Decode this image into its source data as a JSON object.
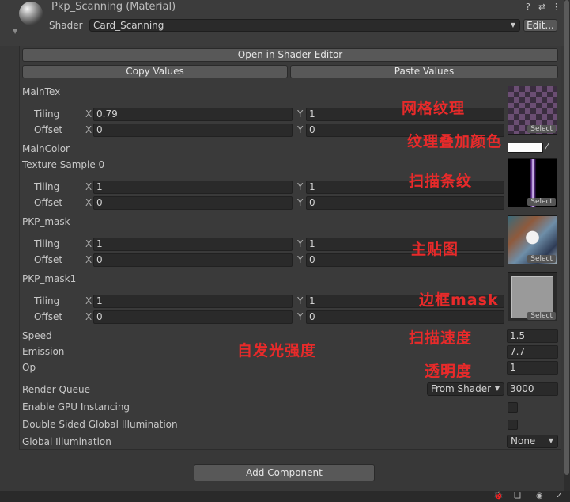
{
  "header": {
    "title": "Pkp_Scanning (Material)",
    "shader_label": "Shader",
    "shader_value": "Card_Scanning",
    "edit_button": "Edit...",
    "help_icon": "?",
    "settings_icon": "⇄",
    "menu_icon": "⋮",
    "fold_icon": "▼"
  },
  "buttons": {
    "open_shader_editor": "Open in Shader Editor",
    "copy_values": "Copy Values",
    "paste_values": "Paste Values",
    "add_component": "Add Component"
  },
  "common": {
    "tiling": "Tiling",
    "offset": "Offset",
    "x": "X",
    "y": "Y",
    "select": "Select",
    "caret": "▼",
    "eyedropper": "⁄"
  },
  "properties": {
    "main_tex": {
      "label": "MainTex",
      "tiling_x": "0.79",
      "tiling_y": "1",
      "offset_x": "0",
      "offset_y": "0"
    },
    "main_color": {
      "label": "MainColor",
      "color": "#ffffff"
    },
    "texture_sample_0": {
      "label": "Texture Sample 0",
      "tiling_x": "1",
      "tiling_y": "1",
      "offset_x": "0",
      "offset_y": "0"
    },
    "pkp_mask": {
      "label": "PKP_mask",
      "tiling_x": "1",
      "tiling_y": "1",
      "offset_x": "0",
      "offset_y": "0"
    },
    "pkp_mask1": {
      "label": "PKP_mask1",
      "tiling_x": "1",
      "tiling_y": "1",
      "offset_x": "0",
      "offset_y": "0"
    },
    "speed": {
      "label": "Speed",
      "value": "1.5"
    },
    "emission": {
      "label": "Emission",
      "value": "7.7"
    },
    "op": {
      "label": "Op",
      "value": "1"
    }
  },
  "advanced": {
    "render_queue_label": "Render Queue",
    "render_queue_mode": "From Shader",
    "render_queue_value": "3000",
    "gpu_instancing_label": "Enable GPU Instancing",
    "double_sided_gi_label": "Double Sided Global Illumination",
    "global_illumination_label": "Global Illumination",
    "global_illumination_value": "None"
  },
  "annotations": {
    "grid_texture": "网格纹理",
    "tint_color": "纹理叠加颜色",
    "scan_stripe": "扫描条纹",
    "main_map": "主贴图",
    "border_mask": "边框mask",
    "scan_speed": "扫描速度",
    "emission_intensity": "自发光强度",
    "opacity": "透明度"
  },
  "footer_icons": [
    "🐞",
    "❏",
    "◉",
    "✓"
  ]
}
